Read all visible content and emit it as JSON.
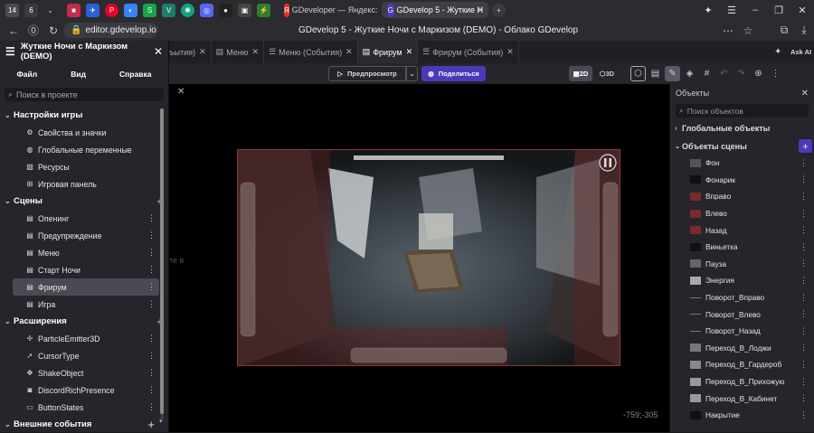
{
  "browser": {
    "tab_counts": [
      "14",
      "6"
    ],
    "tabs": [
      {
        "label": "GDeveloper — Яндекс: на"
      },
      {
        "label": "GDevelop 5 - Жуткие Н"
      }
    ],
    "url": "editor.gdevelop.io",
    "page_title": "GDevelop 5 - Жуткие Ночи с Маркизом (DEMO) - Облако GDevelop",
    "ask_ai": "Ask AI"
  },
  "left_panel": {
    "project_title": "Жуткие Ночи с Маркизом (DEMO)",
    "menu": [
      "Файл",
      "Вид",
      "Справка"
    ],
    "search_placeholder": "Поиск в проекте",
    "sections": [
      {
        "label": "Настройки игры",
        "items": [
          "Свойства и значки",
          "Глобальные переменные",
          "Ресурсы",
          "Игровая панель"
        ]
      },
      {
        "label": "Сцены",
        "items": [
          "Опенинг",
          "Предупреждение",
          "Меню",
          "Старт Ночи",
          "Фрирум",
          "Игра"
        ]
      },
      {
        "label": "Расширения",
        "items": [
          "ParticleEmitter3D",
          "CursorType",
          "ShakeObject",
          "DiscordRichPresence",
          "ButtonStates"
        ]
      },
      {
        "label": "Внешние события",
        "items": []
      }
    ]
  },
  "editor_tabs": [
    "ъытия)",
    "Меню",
    "Меню (События)",
    "Фрирум",
    "Фрирум (События)"
  ],
  "toolbar": {
    "preview_label": "Предпросмотр",
    "share_label": "Поделиться",
    "mode_2d": "2D",
    "mode_3d": "3D"
  },
  "canvas": {
    "coords": "-759;-305",
    "clipped_text": "те в"
  },
  "right_panel": {
    "title": "Объекты",
    "search_placeholder": "Поиск объектов",
    "global_objects": "Глобальные объекты",
    "scene_objects": "Объекты сцены",
    "objects": [
      {
        "name": "Фон",
        "color": "#555555"
      },
      {
        "name": "Фонарик",
        "color": "#111111"
      },
      {
        "name": "Вправо",
        "color": "#7a2a2a"
      },
      {
        "name": "Влево",
        "color": "#7a2a2a"
      },
      {
        "name": "Назад",
        "color": "#7a2a2a"
      },
      {
        "name": "Виньетка",
        "color": "#111111"
      },
      {
        "name": "Пауза",
        "color": "#666666"
      },
      {
        "name": "Энергия",
        "color": "#aaaaaa"
      },
      {
        "name": "Поворот_Вправо",
        "color": "#777777"
      },
      {
        "name": "Поворот_Влево",
        "color": "#777777"
      },
      {
        "name": "Поворот_Назад",
        "color": "#777777"
      },
      {
        "name": "Переход_В_Лоджи",
        "color": "#777777"
      },
      {
        "name": "Переход_В_Гардероб",
        "color": "#888888"
      },
      {
        "name": "Переход_В_Прихожую",
        "color": "#999999"
      },
      {
        "name": "Переход_В_Кабинет",
        "color": "#999999"
      },
      {
        "name": "Накрытие",
        "color": "#111111"
      }
    ]
  },
  "colors": {
    "accent": "#4a3ab8",
    "selected": "#4a4a55"
  }
}
